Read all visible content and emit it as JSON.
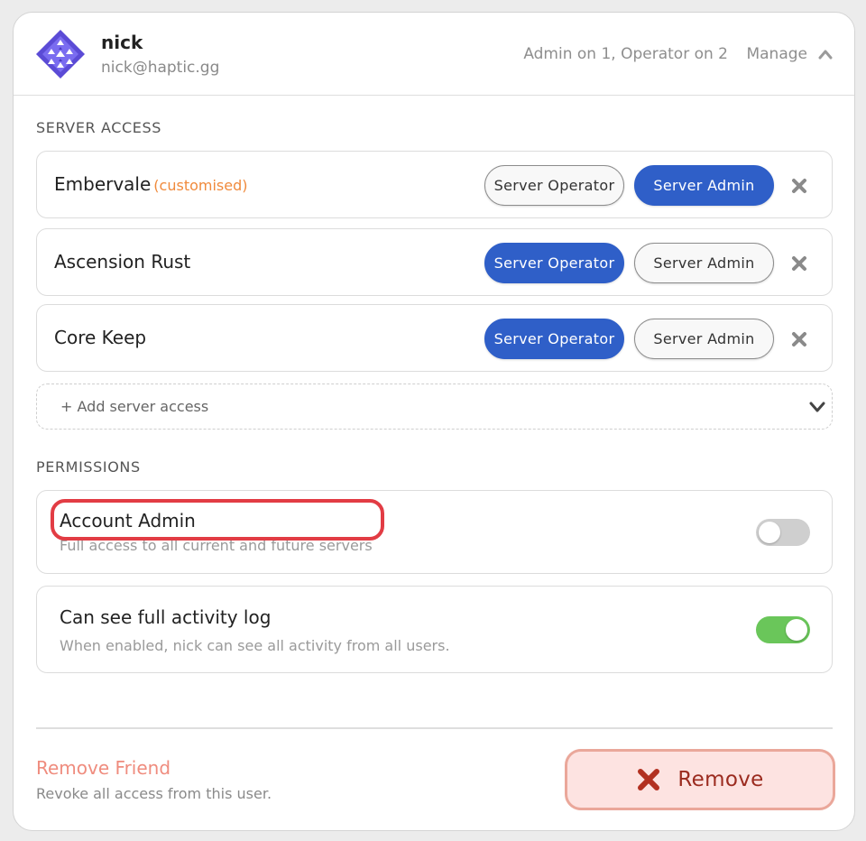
{
  "user": {
    "name": "nick",
    "email": "nick@haptic.gg",
    "access_summary": "Admin on 1, Operator on 2",
    "manage_label": "Manage"
  },
  "server_access": {
    "title": "SERVER ACCESS",
    "servers": [
      {
        "name": "Embervale",
        "tag": "(customised)",
        "operator_label": "Server Operator",
        "admin_label": "Server Admin",
        "role": "admin"
      },
      {
        "name": "Ascension Rust",
        "tag": "",
        "operator_label": "Server Operator",
        "admin_label": "Server Admin",
        "role": "operator"
      },
      {
        "name": "Core Keep",
        "tag": "",
        "operator_label": "Server Operator",
        "admin_label": "Server Admin",
        "role": "operator"
      }
    ],
    "add_label": "+ Add server access"
  },
  "permissions": {
    "title": "PERMISSIONS",
    "items": [
      {
        "title": "Account Admin",
        "description": "Full access to all current and future servers",
        "enabled": false
      },
      {
        "title": "Can see full activity log",
        "description": "When enabled, nick can see all activity from all users.",
        "enabled": true
      }
    ]
  },
  "danger": {
    "title": "Remove Friend",
    "description": "Revoke all access from this user.",
    "button_label": "Remove"
  },
  "colors": {
    "accent": "#2f5fc8",
    "toggle_on": "#6ac65a",
    "toggle_off": "#cfcfcf",
    "customised": "#f08a3c",
    "danger_text": "#ef8c7e",
    "danger_button_bg": "#fde3e1",
    "highlight": "#e23c44"
  }
}
